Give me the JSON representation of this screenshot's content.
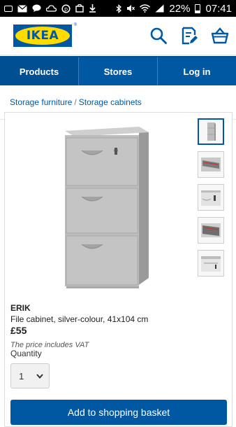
{
  "statusbar": {
    "battery_pct": "22%",
    "time": "07:41",
    "left_icons": [
      "gallery-icon",
      "mail-icon",
      "chat-icon",
      "cloud-icon",
      "sync-icon",
      "store-icon",
      "download-icon"
    ],
    "right_icons": [
      "bluetooth-icon",
      "mute-icon",
      "wifi-icon",
      "signal-icon",
      "battery-icon"
    ]
  },
  "header": {
    "logo_text": "IKEA",
    "logo_mark": "®",
    "icons": [
      "search-icon",
      "shopping-list-icon",
      "basket-icon"
    ],
    "brand_blue": "#0058a3",
    "brand_yellow": "#ffdb00"
  },
  "nav": {
    "items": [
      {
        "label": "Products",
        "active": true
      },
      {
        "label": "Stores",
        "active": false
      },
      {
        "label": "Log in",
        "active": false
      }
    ]
  },
  "breadcrumb": {
    "items": [
      "Storage furniture",
      "Storage cabinets"
    ],
    "separator": "/"
  },
  "product": {
    "name": "ERIK",
    "description": "File cabinet, silver-colour, 41x104 cm",
    "price": "£55",
    "vat_note": "The price includes VAT",
    "quantity_label": "Quantity",
    "quantity_value": "1",
    "add_button": "Add to shopping basket",
    "thumbnail_count": 5,
    "selected_thumbnail": 1
  }
}
